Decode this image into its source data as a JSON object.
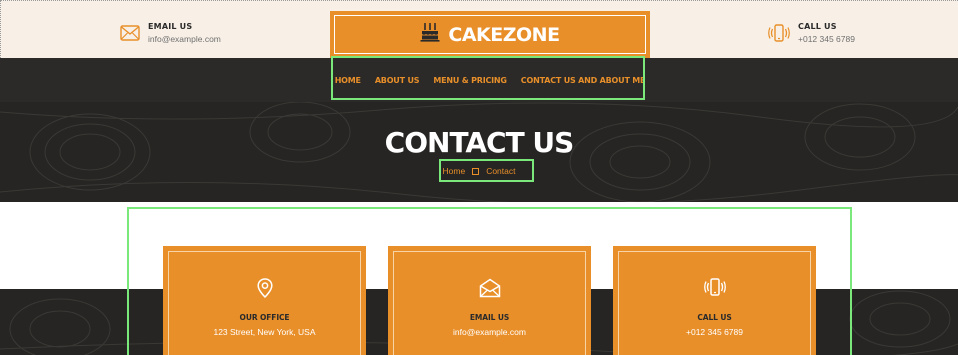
{
  "topbar": {
    "email": {
      "label": "EMAIL US",
      "value": "info@example.com",
      "icon": "envelope-icon"
    },
    "call": {
      "label": "CALL US",
      "value": "+012 345 6789",
      "icon": "phone-vibrate-icon"
    }
  },
  "logo": {
    "text": "CAKEZONE",
    "icon": "cake-icon"
  },
  "nav": {
    "items": [
      "HOME",
      "ABOUT US",
      "MENU & PRICING",
      "CONTACT US AND ABOUT ME"
    ]
  },
  "hero": {
    "title": "CONTACT US",
    "breadcrumb": {
      "home": "Home",
      "current": "Contact"
    }
  },
  "cards": [
    {
      "title": "OUR OFFICE",
      "value": "123 Street, New York, USA",
      "icon": "map-pin-icon"
    },
    {
      "title": "EMAIL US",
      "value": "info@example.com",
      "icon": "envelope-open-icon"
    },
    {
      "title": "CALL US",
      "value": "+012 345 6789",
      "icon": "phone-vibrate-icon"
    }
  ],
  "colors": {
    "accent": "#e88f2a",
    "dark": "#262523",
    "topbar_bg": "#f8f0e7",
    "highlight": "#7be87b"
  }
}
